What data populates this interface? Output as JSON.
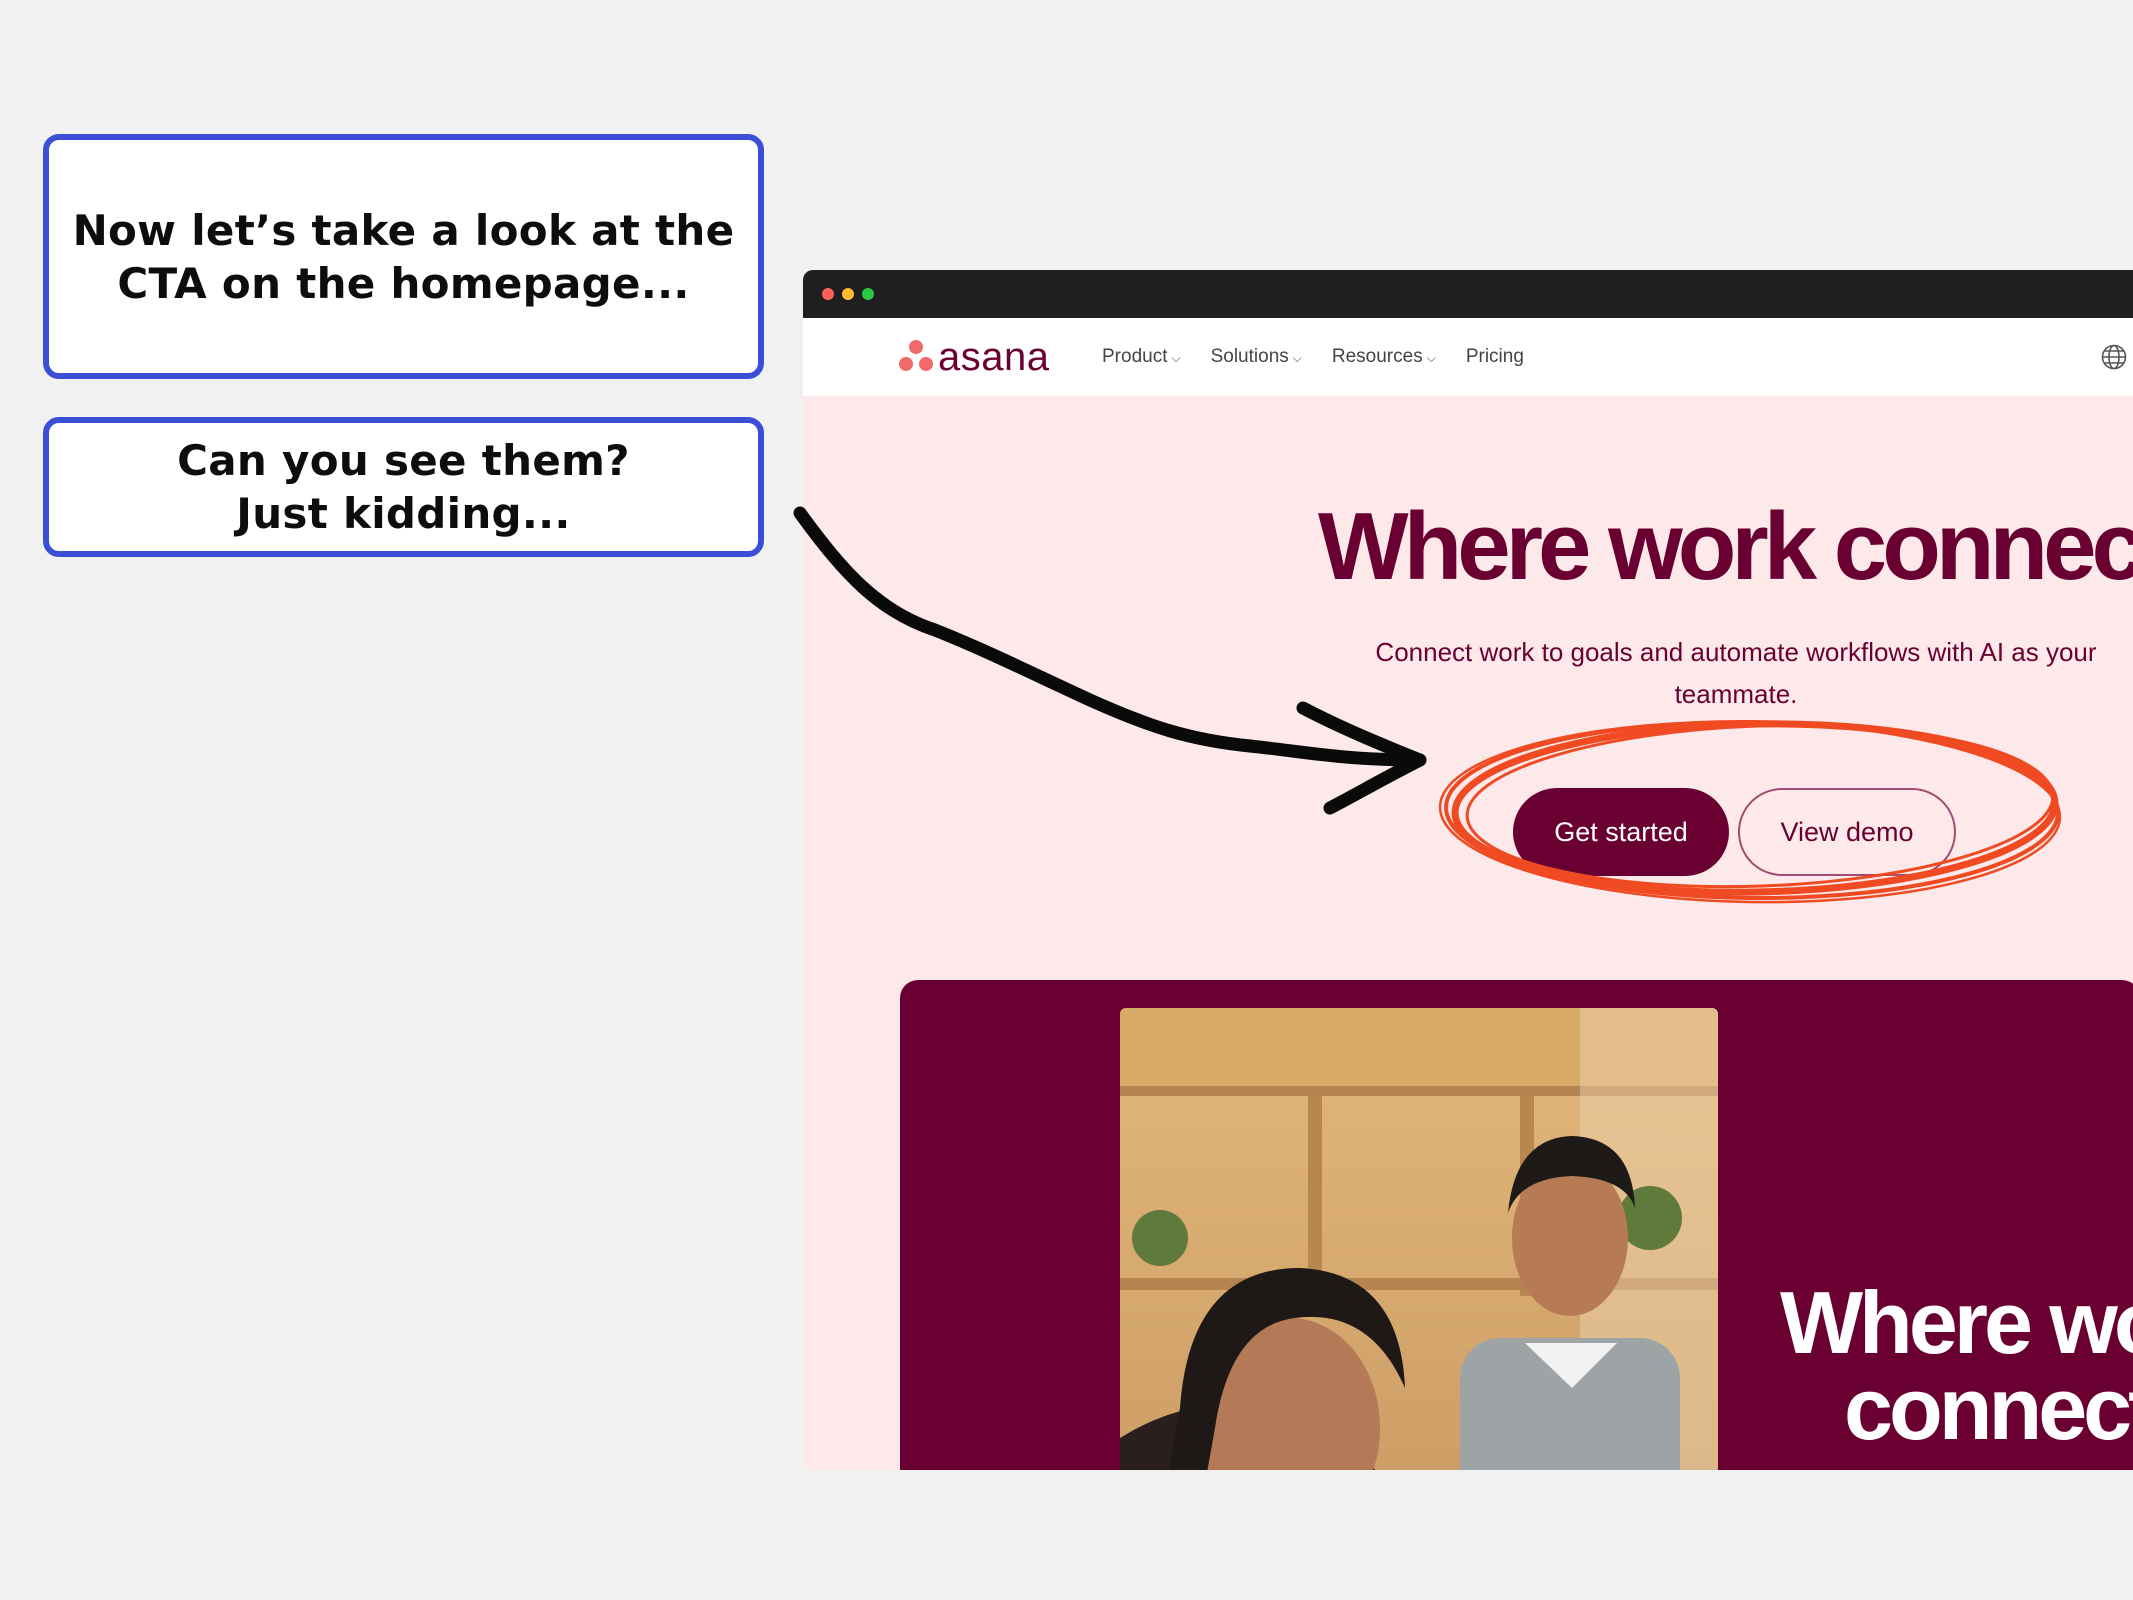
{
  "callouts": {
    "first": {
      "line1": "Now let’s take a look at the",
      "line2": "CTA on the homepage..."
    },
    "second": {
      "line1": "Can you see them?",
      "line2": "Just kidding..."
    }
  },
  "browser": {
    "logo_text": "asana",
    "nav": [
      "Product",
      "Solutions",
      "Resources",
      "Pricing"
    ],
    "hero": {
      "title": "Where work connects",
      "subtitle": "Connect work to goals and automate workflows with AI as your teammate.",
      "primary_cta": "Get started",
      "secondary_cta": "View demo"
    },
    "video": {
      "line1": "Where work",
      "line2": "connects"
    }
  },
  "colors": {
    "callout_border": "#3a4fd6",
    "brand_plum": "#690031",
    "hero_bg": "#fde9ea",
    "logo_coral": "#f06a6a",
    "highlight_circle": "#f04a22"
  },
  "icons": [
    "asana-logo-icon",
    "chevron-down-icon",
    "globe-icon",
    "arrow-annotation-icon",
    "circle-highlight-annotation"
  ]
}
